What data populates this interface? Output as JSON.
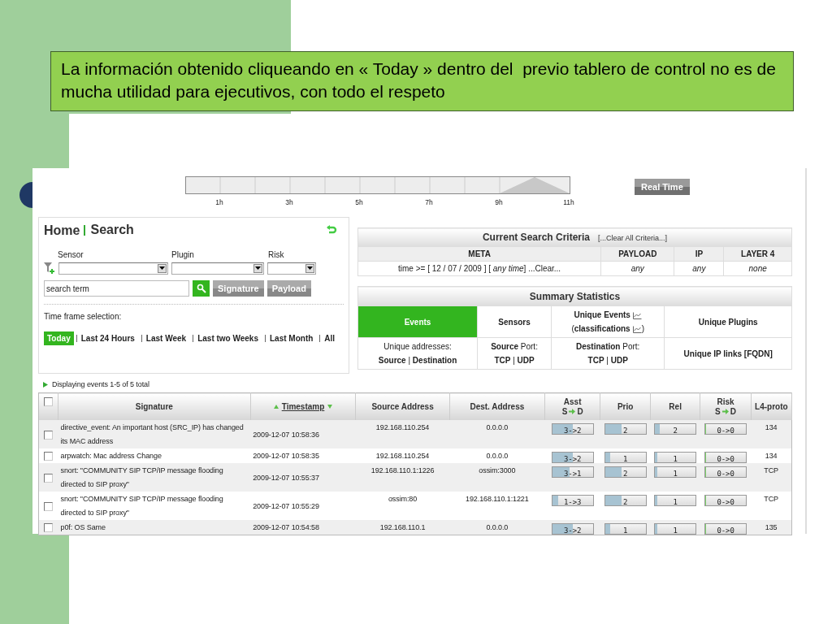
{
  "callout": {
    "text": "La información obtenido cliqueando en « Today » dentro del  previo tablero de control no es de mucha utilidad para ejecutivos, con todo el respeto"
  },
  "timeline": {
    "ticks": [
      "1h",
      "3h",
      "5h",
      "7h",
      "9h",
      "11h"
    ],
    "button": "Real Time"
  },
  "heading": {
    "home": "Home",
    "section": "Search"
  },
  "filters": [
    {
      "label": "Sensor"
    },
    {
      "label": "Plugin"
    },
    {
      "label": "Risk"
    }
  ],
  "search": {
    "value": "search term",
    "buttons": [
      "Signature",
      "Payload"
    ]
  },
  "time_frame": {
    "label": "Time frame selection:",
    "options": [
      {
        "label": "Today",
        "selected": true
      },
      {
        "label": "Last 24 Hours",
        "selected": false
      },
      {
        "label": "Last Week",
        "selected": false
      },
      {
        "label": "Last two Weeks",
        "selected": false
      },
      {
        "label": "Last Month",
        "selected": false
      },
      {
        "label": "All",
        "selected": false
      }
    ]
  },
  "criteria": {
    "title": "Current Search Criteria",
    "clear": "[...Clear All Criteria...]",
    "columns": [
      "META",
      "PAYLOAD",
      "IP",
      "LAYER 4"
    ],
    "values": [
      "time >= [ 12 / 07 / 2009 ] [ *any time*]   ...Clear...",
      "any",
      "any",
      "none"
    ]
  },
  "summary": {
    "title": "Summary Statistics",
    "rows": [
      [
        {
          "kind": "plain",
          "selected": true,
          "lines": [
            {
              "text": "**Events**"
            }
          ]
        },
        {
          "kind": "plain",
          "selected": false,
          "lines": [
            {
              "text": "**Sensors**"
            }
          ]
        },
        {
          "kind": "chart-link",
          "selected": false,
          "lines": [
            {
              "text": "**Unique Events**"
            },
            {
              "text": "(**classifications**",
              "after": ")"
            }
          ]
        },
        {
          "kind": "plain",
          "selected": false,
          "lines": [
            {
              "text": "**Unique Plugins**"
            }
          ]
        }
      ],
      [
        {
          "kind": "plain",
          "selected": false,
          "lines": [
            {
              "text": "Unique addresses:"
            },
            {
              "text": "**Source** | **Destination**"
            }
          ]
        },
        {
          "kind": "plain",
          "selected": false,
          "lines": [
            {
              "text": "**Source** Port:"
            },
            {
              "text": "**TCP** | **UDP**"
            }
          ]
        },
        {
          "kind": "plain",
          "selected": false,
          "lines": [
            {
              "text": "**Destination** Port:"
            },
            {
              "text": "**TCP** | **UDP**"
            }
          ]
        },
        {
          "kind": "plain",
          "selected": false,
          "lines": [
            {
              "text": "**Unique IP links [FQDN]**"
            }
          ]
        }
      ]
    ]
  },
  "events": {
    "status": "Displaying events 1-5 of 5 total",
    "select_all": {
      "checked": false
    },
    "columns": [
      {
        "kind": "plain",
        "label": "Signature"
      },
      {
        "kind": "sort",
        "label": "Timestamp"
      },
      {
        "kind": "plain",
        "label": "Source Address"
      },
      {
        "kind": "plain",
        "label": "Dest. Address"
      },
      {
        "kind": "flow",
        "label": "Asst",
        "from": "S",
        "to": "D"
      },
      {
        "kind": "plain",
        "label": "Prio"
      },
      {
        "kind": "plain",
        "label": "Rel"
      },
      {
        "kind": "flow",
        "label": "Risk",
        "from": "S",
        "to": "D"
      },
      {
        "kind": "plain",
        "label": "L4-proto"
      }
    ],
    "rows": [
      {
        "checked": false,
        "signature": "directive_event: An important host (SRC_IP) has changed its MAC address",
        "timestamp": "2009-12-07 10:58:36",
        "source": "192.168.110.254",
        "dest": "0.0.0.0",
        "asst": {
          "reading": "3->2",
          "level": 0.5
        },
        "prio": {
          "reading": "2",
          "level": 0.4
        },
        "rel": {
          "reading": "2",
          "level": 0.12
        },
        "risk": {
          "reading": "0->0",
          "level": 0.02
        },
        "proto": "134"
      },
      {
        "checked": false,
        "signature": "arpwatch: Mac address Change",
        "timestamp": "2009-12-07 10:58:35",
        "source": "192.168.110.254",
        "dest": "0.0.0.0",
        "asst": {
          "reading": "3->2",
          "level": 0.5
        },
        "prio": {
          "reading": "1",
          "level": 0.12
        },
        "rel": {
          "reading": "1",
          "level": 0.05
        },
        "risk": {
          "reading": "0->0",
          "level": 0.02
        },
        "proto": "134"
      },
      {
        "checked": false,
        "signature": "snort: \"COMMUNITY SIP TCP/IP message flooding directed to SIP proxy\"",
        "timestamp": "2009-12-07 10:55:37",
        "source": "192.168.110.1:1226",
        "dest": "ossim:3000",
        "asst": {
          "reading": "3->1",
          "level": 0.42
        },
        "prio": {
          "reading": "2",
          "level": 0.4
        },
        "rel": {
          "reading": "1",
          "level": 0.05
        },
        "risk": {
          "reading": "0->0",
          "level": 0.02
        },
        "proto": "TCP"
      },
      {
        "checked": false,
        "signature": "snort: \"COMMUNITY SIP TCP/IP message flooding directed to SIP proxy\"",
        "timestamp": "2009-12-07 10:55:29",
        "source": "ossim:80",
        "dest": "192.168.110.1:1221",
        "asst": {
          "reading": "1->3",
          "level": 0.15
        },
        "prio": {
          "reading": "2",
          "level": 0.4
        },
        "rel": {
          "reading": "1",
          "level": 0.05
        },
        "risk": {
          "reading": "0->0",
          "level": 0.02
        },
        "proto": "TCP"
      },
      {
        "checked": false,
        "signature": "p0f: OS Same",
        "timestamp": "2009-12-07 10:54:58",
        "source": "192.168.110.1",
        "dest": "0.0.0.0",
        "asst": {
          "reading": "3->2",
          "level": 0.5
        },
        "prio": {
          "reading": "1",
          "level": 0.12
        },
        "rel": {
          "reading": "1",
          "level": 0.05
        },
        "risk": {
          "reading": "0->0",
          "level": 0.02
        },
        "proto": "135"
      }
    ]
  }
}
